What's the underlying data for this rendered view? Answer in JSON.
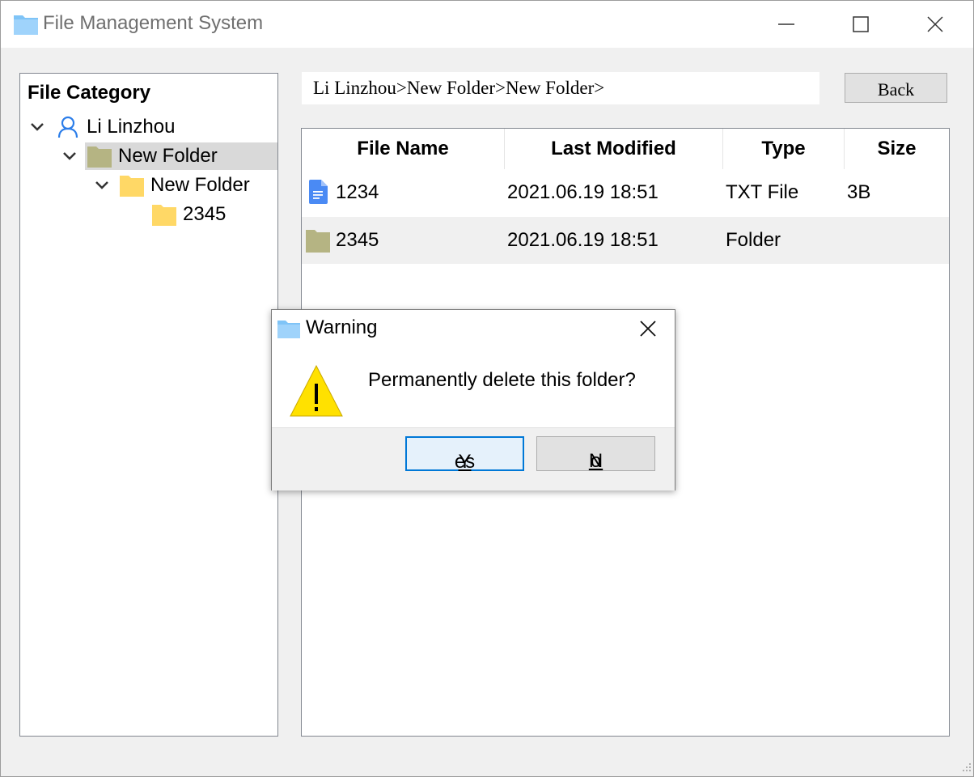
{
  "window": {
    "title": "File Management System",
    "icon": "folder-icon"
  },
  "tree": {
    "title": "File Category",
    "root": {
      "label": "Li Linzhou",
      "icon": "user-icon"
    },
    "items": [
      {
        "label": "New Folder",
        "level": 1,
        "expanded": true,
        "selected": true,
        "color": "#b5b483"
      },
      {
        "label": "New Folder",
        "level": 2,
        "expanded": true,
        "selected": false,
        "color": "#ffd866"
      },
      {
        "label": "2345",
        "level": 3,
        "expanded": false,
        "selected": false,
        "color": "#ffd866"
      }
    ]
  },
  "breadcrumb": {
    "path": "Li Linzhou>New Folder>New Folder>"
  },
  "toolbar": {
    "back_label": "Back"
  },
  "file_list": {
    "columns": [
      "File Name",
      "Last Modified",
      "Type",
      "Size"
    ],
    "rows": [
      {
        "name": "1234",
        "modified": "2021.06.19 18:51",
        "type": "TXT File",
        "size": "3B",
        "icon": "txt-file-icon"
      },
      {
        "name": "2345",
        "modified": "2021.06.19 18:51",
        "type": "Folder",
        "size": "",
        "icon": "folder-icon"
      }
    ]
  },
  "dialog": {
    "title": "Warning",
    "message": "Permanently delete this folder?",
    "yes_mnemonic": "Y",
    "yes_rest": "es",
    "no_mnemonic": "N",
    "no_rest": "o"
  },
  "colors": {
    "accent": "#0078d7",
    "selected_folder": "#b5b483",
    "folder": "#ffd866",
    "warning": "#ffe100"
  }
}
